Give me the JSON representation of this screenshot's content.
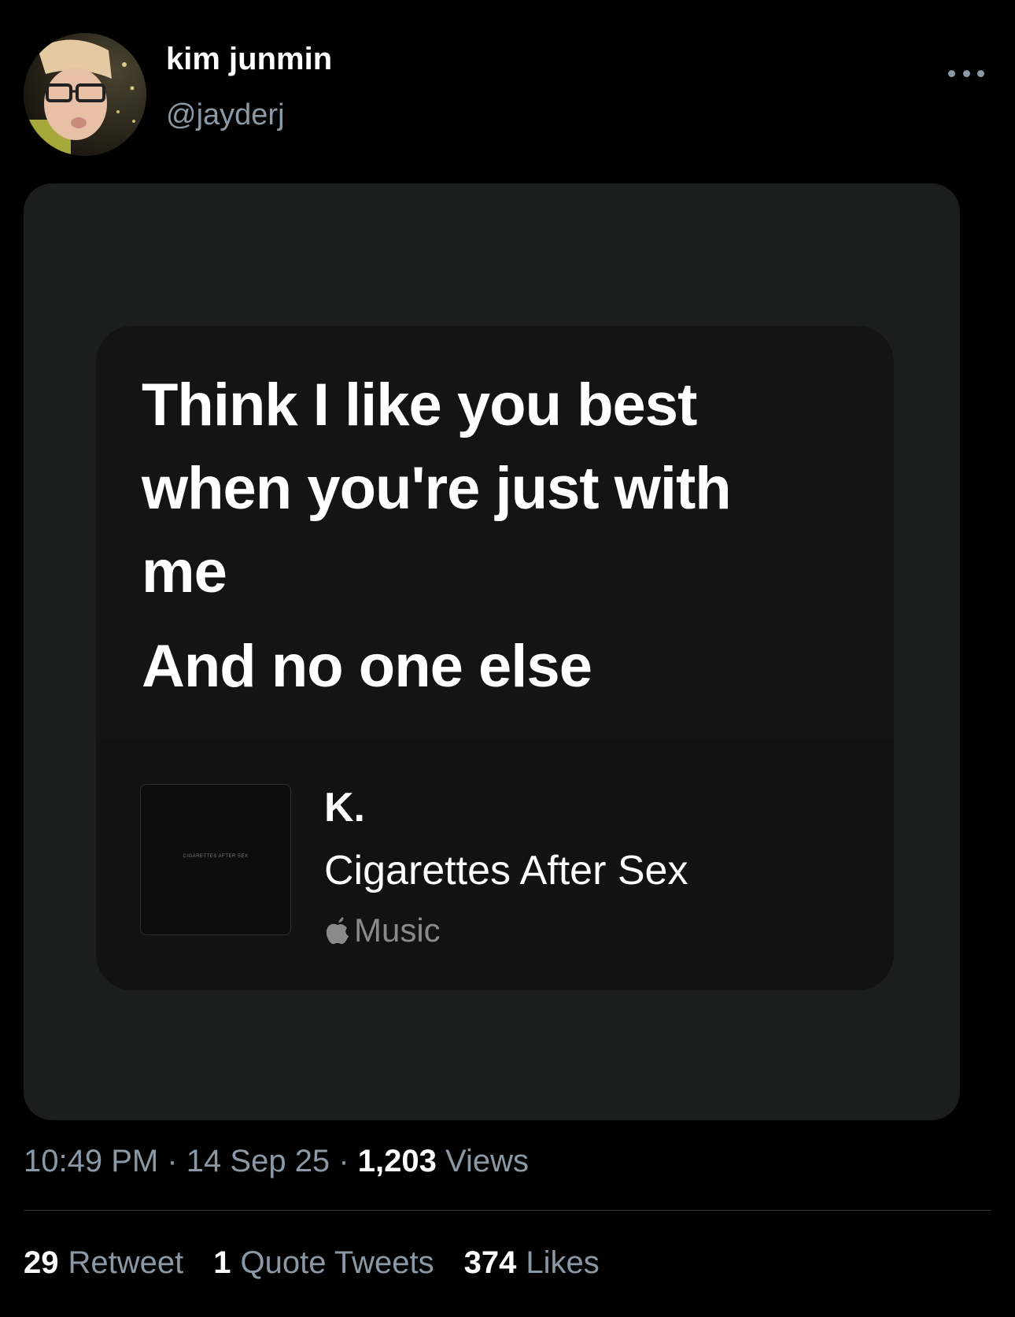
{
  "tweet": {
    "author": {
      "display_name": "kim junmin",
      "handle": "@jayderj",
      "avatar_icon": "profile-photo"
    },
    "more_icon": "more-horizontal-icon",
    "media": {
      "lyrics": [
        "Think I like you best",
        "when you're just with",
        "me",
        "And no one else"
      ],
      "song": {
        "title": "K.",
        "artist": "Cigarettes After Sex",
        "service_label": "Music",
        "service_icon": "apple-logo-icon",
        "album_art_text": "CIGARETTES AFTER SEX"
      }
    },
    "meta": {
      "time": "10:49 PM",
      "separator1": "·",
      "date": "14 Sep 25",
      "separator2": "·",
      "views_count": "1,203",
      "views_label": "Views"
    },
    "stats": {
      "retweets_count": "29",
      "retweets_label": "Retweet",
      "quotes_count": "1",
      "quotes_label": "Quote Tweets",
      "likes_count": "374",
      "likes_label": "Likes"
    },
    "colors": {
      "background": "#000000",
      "muted_text": "#8b98a5",
      "media_frame": "#1c1d1d",
      "share_card": "#141414"
    }
  }
}
